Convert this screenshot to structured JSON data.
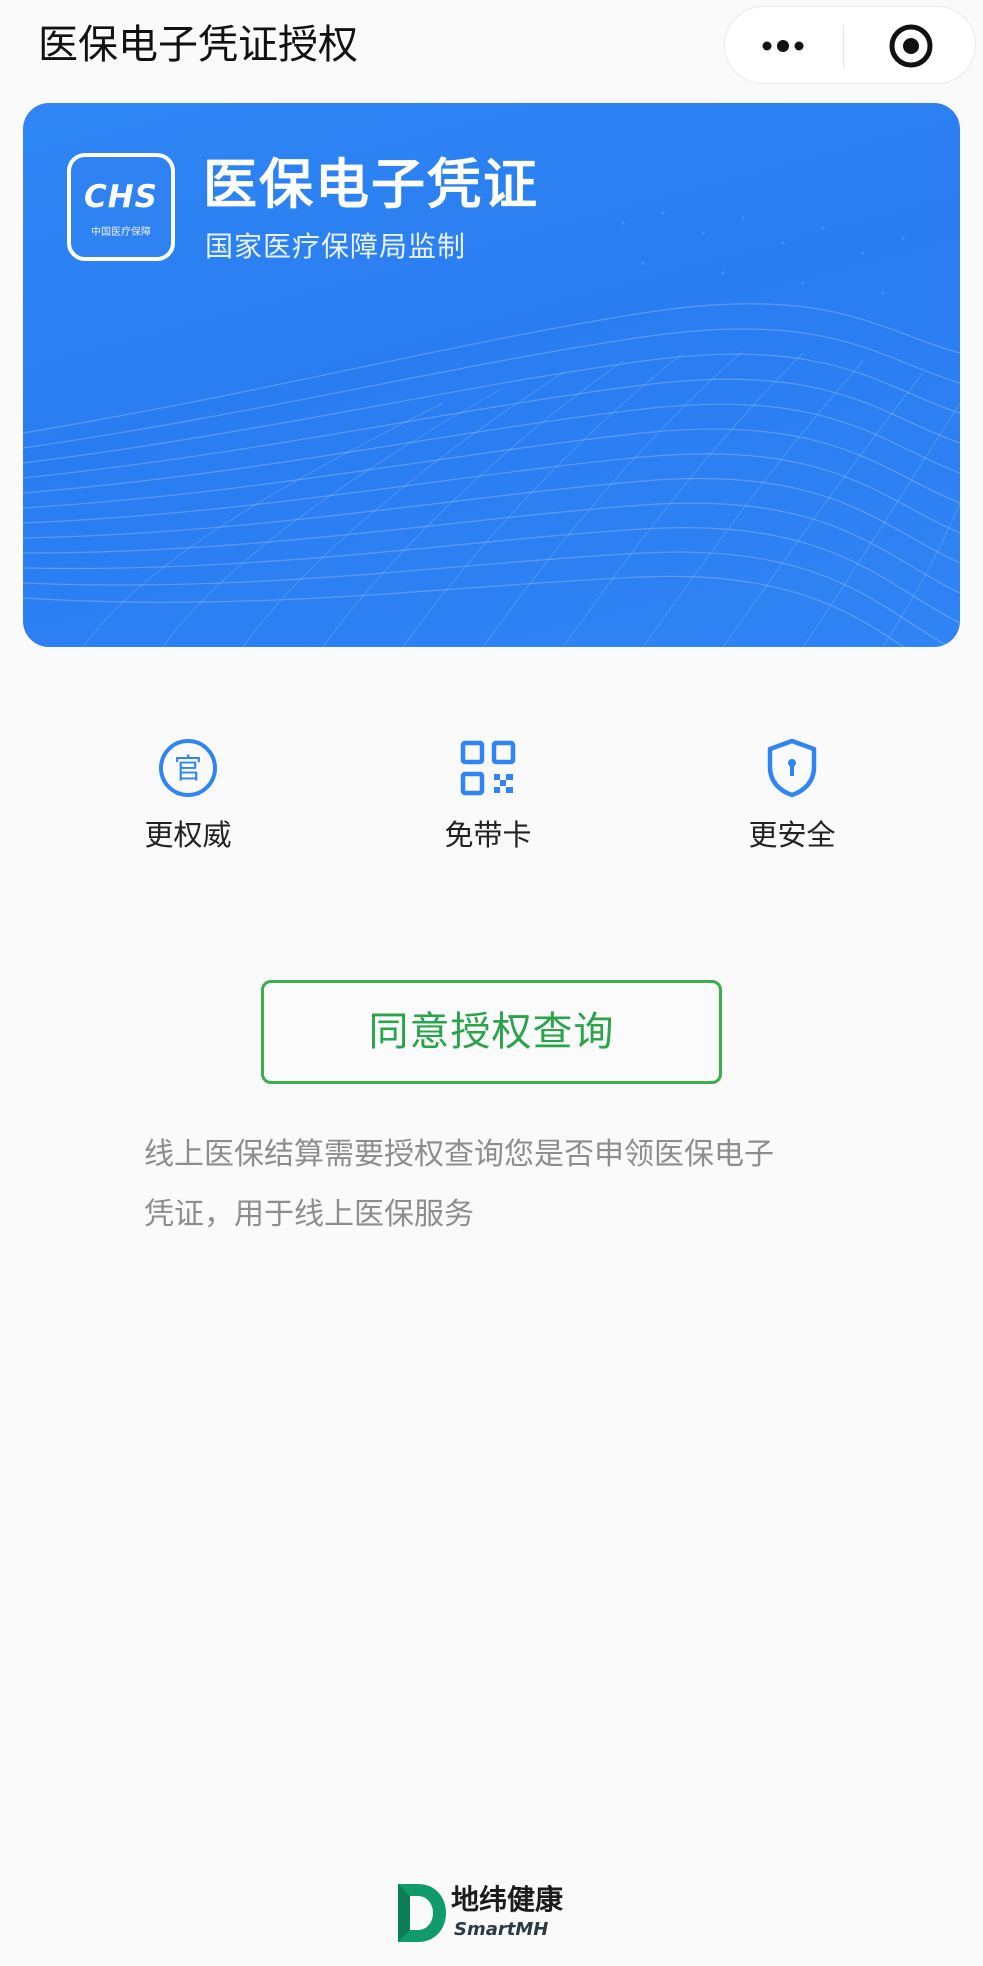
{
  "nav": {
    "title": "医保电子凭证授权",
    "more_icon": "more-dots-icon",
    "close_icon": "target-circle-icon"
  },
  "hero": {
    "logo_text": "CHS",
    "logo_subtext": "中国医疗保障",
    "title": "医保电子凭证",
    "subtitle": "国家医疗保障局监制",
    "background_color": "#2d80f3"
  },
  "features": [
    {
      "label": "更权威",
      "icon": "official-seal-icon"
    },
    {
      "label": "免带卡",
      "icon": "qr-code-icon"
    },
    {
      "label": "更安全",
      "icon": "shield-lock-icon"
    }
  ],
  "agree_button": {
    "label": "同意授权查询",
    "color": "#2aa44a"
  },
  "description": {
    "line1": "线上医保结算需要授权查询您是否申领医保电子",
    "line2": "凭证，用于线上医保服务"
  },
  "footer": {
    "brand_name": "地纬健康",
    "brand_en": "SmartMH"
  },
  "colors": {
    "accent_blue": "#2f85f4",
    "accent_green": "#3aae4a",
    "text_gray": "#8d8d8d"
  }
}
